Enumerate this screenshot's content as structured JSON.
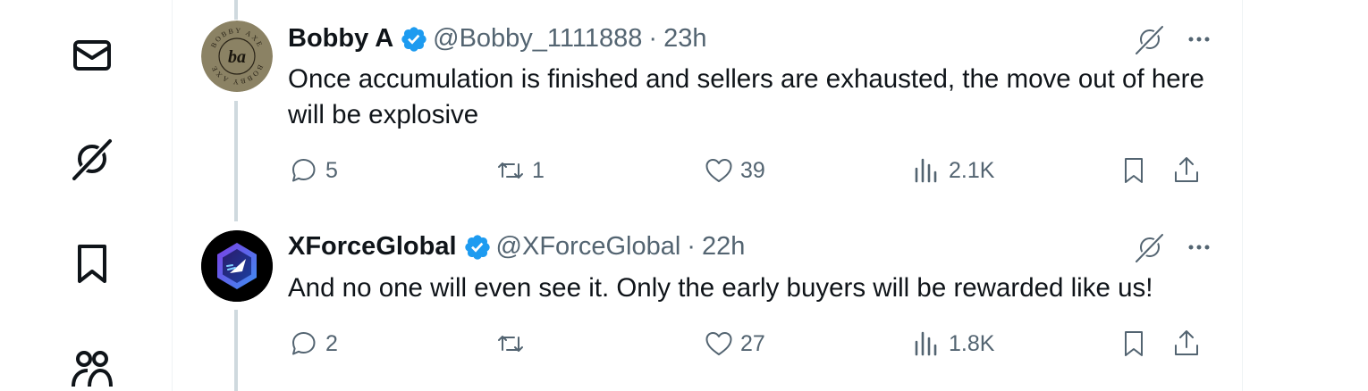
{
  "nav": {
    "items": [
      {
        "name": "messages",
        "icon": "envelope-icon"
      },
      {
        "name": "grok",
        "icon": "grok-icon"
      },
      {
        "name": "bookmarks",
        "icon": "bookmark-icon"
      },
      {
        "name": "communities",
        "icon": "people-icon"
      }
    ]
  },
  "tweets": [
    {
      "name": "Bobby A",
      "handle": "@Bobby_1111888",
      "separator": "·",
      "time": "23h",
      "text": "Once accumulation is finished and sellers are exhausted, the move out of here will be explosive",
      "avatar_text": "ba",
      "avatar_ring_text": "BOBBY AXE",
      "replies": "5",
      "reposts": "1",
      "likes": "39",
      "views": "2.1K"
    },
    {
      "name": "XForceGlobal",
      "handle": "@XForceGlobal",
      "separator": "·",
      "time": "22h",
      "text": "And no one will even see it. Only the early buyers will be rewarded like us!",
      "replies": "2",
      "reposts": "",
      "likes": "27",
      "views": "1.8K"
    }
  ],
  "colors": {
    "verified": "#1d9bf0",
    "secondary_text": "#536471",
    "primary_text": "#0f1419",
    "thread_line": "#cfd9de"
  }
}
